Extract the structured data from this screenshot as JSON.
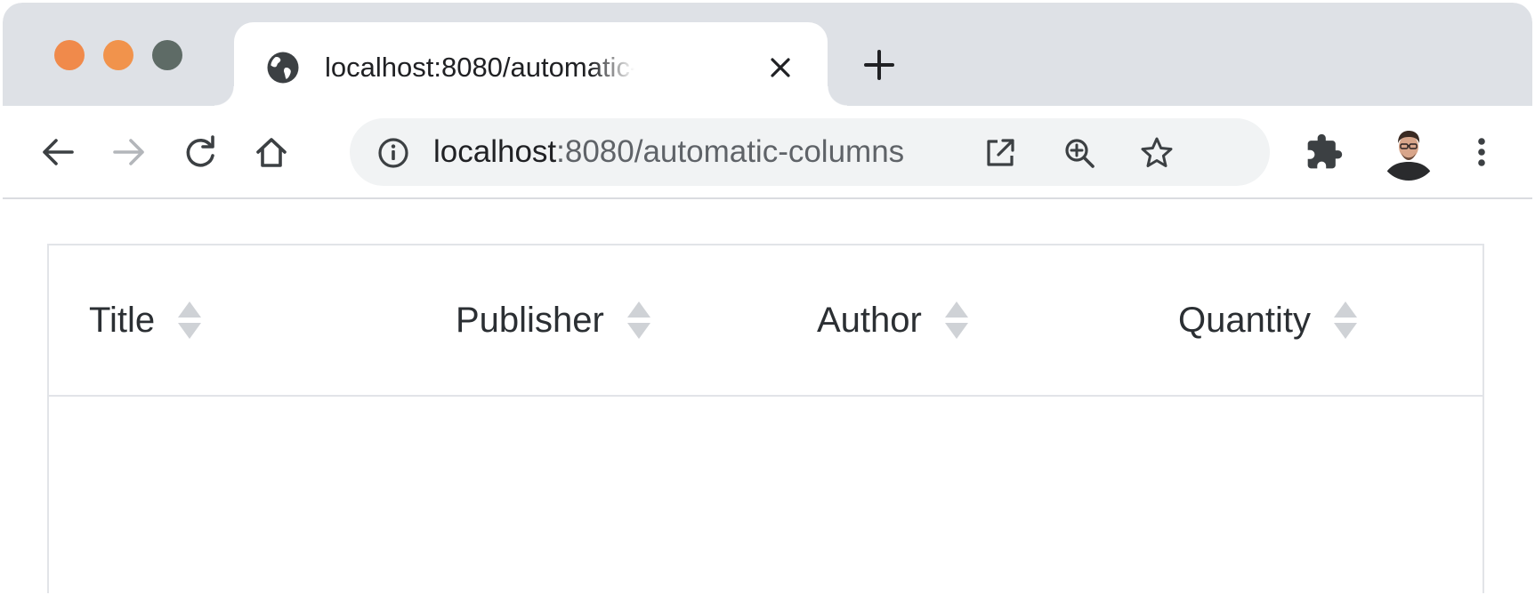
{
  "tab": {
    "title": "localhost:8080/automatic-columns"
  },
  "omnibox": {
    "url_host": "localhost",
    "url_rest": ":8080/automatic-columns"
  },
  "table": {
    "columns": [
      "Title",
      "Publisher",
      "Author",
      "Quantity"
    ]
  },
  "colors": {
    "traffic_close": "#f08a4b",
    "traffic_minimize": "#f1934c",
    "traffic_maximize": "#5e6b66",
    "tabstrip": "#dee1e6",
    "omnibox": "#f1f3f4",
    "table_border": "#e2e4e8",
    "header_text": "#2b2f33",
    "sort_icon": "#cfd2d6"
  },
  "icons": {
    "favicon": "globe-icon",
    "tab_close": "close-icon",
    "new_tab": "plus-icon",
    "back": "arrow-left-icon",
    "forward": "arrow-right-icon",
    "reload": "reload-icon",
    "home": "home-icon",
    "site_info": "info-icon",
    "open_in_window": "open-external-icon",
    "zoom": "zoom-in-icon",
    "bookmark": "star-icon",
    "extensions": "puzzle-icon",
    "profile": "avatar",
    "menu": "kebab-menu-icon",
    "sort": "sort-icon"
  }
}
